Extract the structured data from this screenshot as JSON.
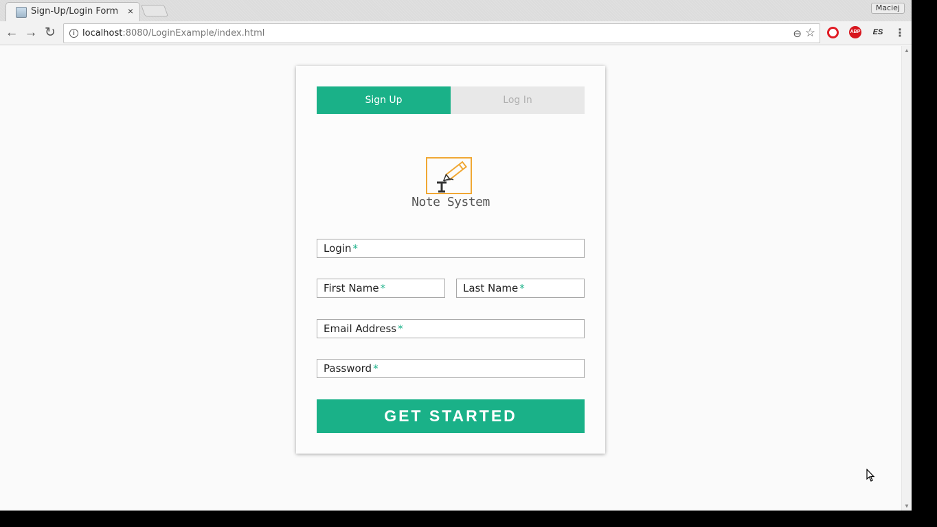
{
  "browser": {
    "tab_title": "Sign-Up/Login Form",
    "tab_close": "×",
    "profile_name": "Maciej",
    "url_host": "localhost",
    "url_rest": ":8080/LoginExample/index.html",
    "back": "←",
    "forward": "→",
    "reload": "↻",
    "info": "i",
    "zoom": "⊖",
    "star": "☆",
    "ext_abp": "ABP",
    "ext_es": "ES",
    "menu": "⋮"
  },
  "form": {
    "tabs": [
      {
        "label": "Sign Up",
        "active": true
      },
      {
        "label": "Log In",
        "active": false
      }
    ],
    "logo_text": "Note System",
    "fields": {
      "login": {
        "label": "Login",
        "required": "*"
      },
      "first_name": {
        "label": "First Name",
        "required": "*"
      },
      "last_name": {
        "label": "Last Name",
        "required": "*"
      },
      "email": {
        "label": "Email Address",
        "required": "*"
      },
      "password": {
        "label": "Password",
        "required": "*"
      }
    },
    "submit_label": "GET STARTED"
  },
  "colors": {
    "accent": "#1ab188",
    "inactive_tab": "#e8e8e8",
    "logo_orange": "#f0a733"
  }
}
